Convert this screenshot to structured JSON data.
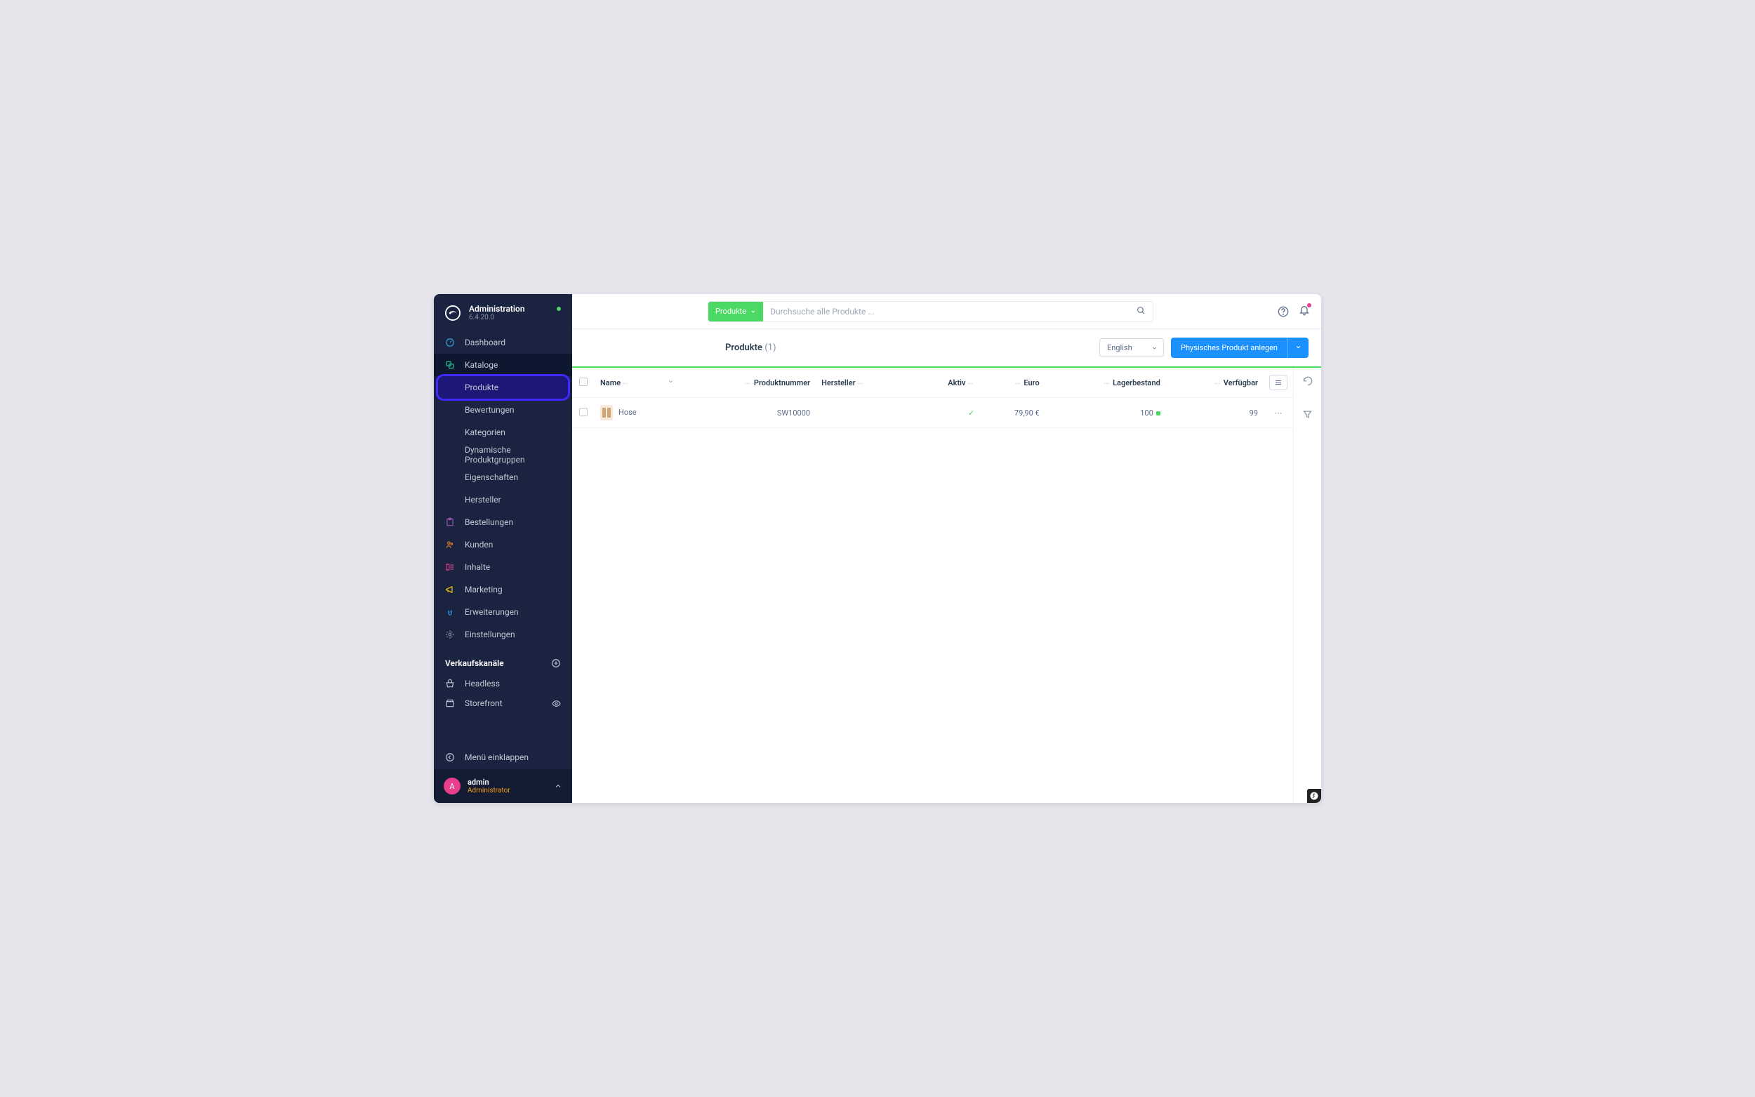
{
  "brand": {
    "title": "Administration",
    "version": "6.4.20.0"
  },
  "nav": {
    "dashboard": "Dashboard",
    "catalogs": "Kataloge",
    "products": "Produkte",
    "reviews": "Bewertungen",
    "categories": "Kategorien",
    "dynamic_groups": "Dynamische Produktgruppen",
    "properties": "Eigenschaften",
    "manufacturers": "Hersteller",
    "orders": "Bestellungen",
    "customers": "Kunden",
    "content": "Inhalte",
    "marketing": "Marketing",
    "extensions": "Erweiterungen",
    "settings": "Einstellungen"
  },
  "channels": {
    "title": "Verkaufskanäle",
    "headless": "Headless",
    "storefront": "Storefront"
  },
  "collapse": "Menü einklappen",
  "user": {
    "initial": "A",
    "name": "admin",
    "role": "Administrator"
  },
  "search": {
    "scope": "Produkte",
    "placeholder": "Durchsuche alle Produkte ..."
  },
  "page": {
    "title": "Produkte",
    "count": "(1)"
  },
  "controls": {
    "language": "English",
    "create": "Physisches Produkt anlegen"
  },
  "columns": {
    "name": "Name",
    "number": "Produktnummer",
    "manufacturer": "Hersteller",
    "active": "Aktiv",
    "euro": "Euro",
    "stock": "Lagerbestand",
    "available": "Verfügbar"
  },
  "row": {
    "name": "Hose",
    "number": "SW10000",
    "manufacturer": "",
    "price": "79,90 €",
    "stock": "100",
    "available": "99"
  }
}
